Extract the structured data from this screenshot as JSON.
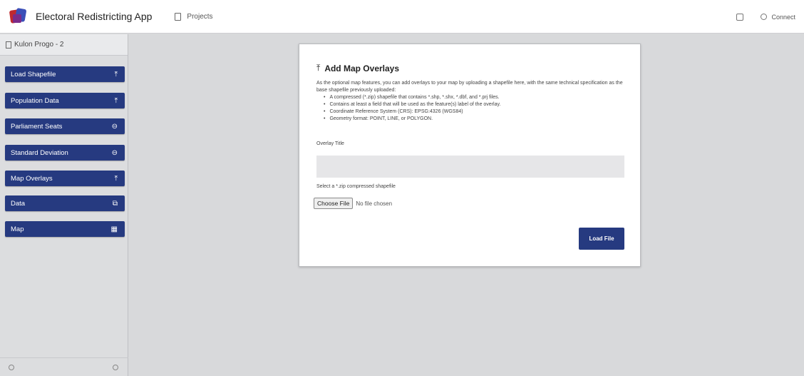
{
  "header": {
    "app_title": "Electoral Redistricting App",
    "projects_label": "Projects",
    "connect_label": "Connect"
  },
  "sidebar": {
    "project_name": "Kulon Progo - 2",
    "items": [
      {
        "label": "Load Shapefile",
        "icon": "upload-icon",
        "glyph": "⤒"
      },
      {
        "label": "Population Data",
        "icon": "upload-icon",
        "glyph": "⤒"
      },
      {
        "label": "Parliament Seats",
        "icon": "circle-arrow-icon",
        "glyph": "⊖"
      },
      {
        "label": "Standard Deviation",
        "icon": "circle-arrow-icon",
        "glyph": "⊖"
      },
      {
        "label": "Map Overlays",
        "icon": "upload-icon",
        "glyph": "⤒"
      },
      {
        "label": "Data",
        "icon": "table-icon",
        "glyph": "⧉"
      },
      {
        "label": "Map",
        "icon": "map-icon",
        "glyph": "▦"
      }
    ]
  },
  "modal": {
    "title": "Add Map Overlays",
    "intro": "As the optional map features, you can add overlays to your map by uploading a shapefile here, with the same technical specification as the base shapefile previously uploaded:",
    "requirements": [
      "A compressed (*.zip) shapefile that contains *.shp, *.shx, *.dbf, and *.prj files.",
      "Contains at least a field that will be used as the feature(s) label of the overlay.",
      "Coordinate Reference System (CRS): EPSG:4326 (WGS84)",
      "Geometry format: POINT, LINE, or POLYGON."
    ],
    "overlay_title_label": "Overlay Title",
    "overlay_title_value": "",
    "select_label": "Select a *.zip compressed shapefile",
    "choose_file_label": "Choose File",
    "no_file_label": "No file chosen",
    "load_button_label": "Load File"
  },
  "colors": {
    "primary": "#263a80",
    "background": "#d8d9db"
  }
}
